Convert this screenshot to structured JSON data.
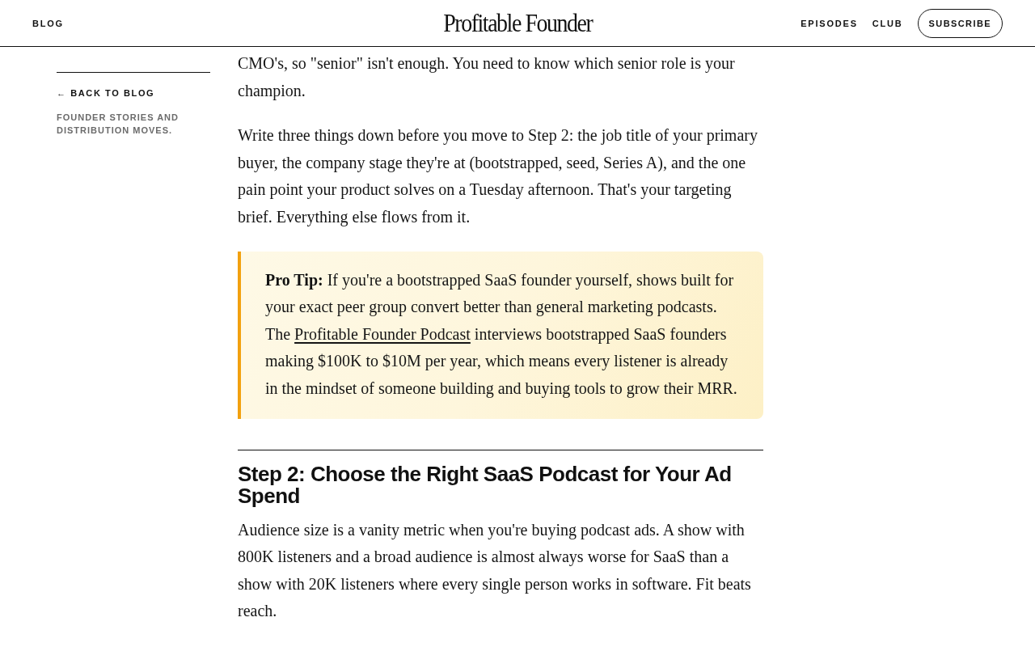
{
  "header": {
    "nav_left": [
      {
        "label": "BLOG"
      }
    ],
    "logo": "Profitable Founder",
    "nav_right": [
      {
        "label": "EPISODES"
      },
      {
        "label": "CLUB"
      }
    ],
    "subscribe_button": "SUBSCRIBE"
  },
  "sidebar": {
    "back_link": "← BACK TO BLOG",
    "tagline": "FOUNDER STORIES AND DISTRIBUTION MOVES."
  },
  "article": [
    {
      "kind": "paragraph",
      "text": "CMO's, so \"senior\" isn't enough. You need to know which senior role is your champion."
    },
    {
      "kind": "paragraph",
      "text": "Write three things down before you move to Step 2: the job title of your primary buyer, the company stage they're at (bootstrapped, seed, Series A), and the one pain point your product solves on a Tuesday afternoon. That's your targeting brief. Everything else flows from it."
    },
    {
      "kind": "callout",
      "label": "Pro Tip:",
      "before": "If you're a bootstrapped SaaS founder yourself, shows built for your exact peer group convert better than general marketing podcasts. The ",
      "link": "Profitable Founder Podcast",
      "after": " interviews bootstrapped SaaS founders making $100K to $10M per year, which means every listener is already in the mindset of someone building and buying tools to grow their MRR."
    },
    {
      "kind": "heading",
      "text": "Step 2: Choose the Right SaaS Podcast for Your Ad Spend"
    },
    {
      "kind": "paragraph",
      "text": "Audience size is a vanity metric when you're buying podcast ads. A show with 800K listeners and a broad audience is almost always worse for SaaS than a show with 20K listeners where every single person works in software. Fit beats reach."
    }
  ]
}
